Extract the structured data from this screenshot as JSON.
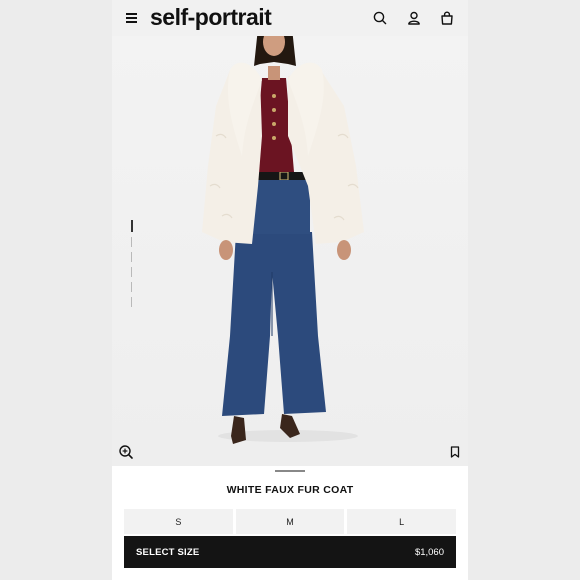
{
  "header": {
    "brand": "self-portrait",
    "icons": [
      "menu-icon",
      "search-icon",
      "account-icon",
      "bag-icon"
    ]
  },
  "gallery": {
    "image_alt": "Model wearing white faux fur coat, burgundy top and flared blue jeans",
    "page_count": 7,
    "active_page": 1
  },
  "product": {
    "title": "WHITE FAUX FUR COAT",
    "sizes": [
      "S",
      "M",
      "L"
    ],
    "cta_label": "SELECT SIZE",
    "price": "$1,060"
  },
  "colors": {
    "cta_background": "#141414",
    "coat": "#f4efe7",
    "top": "#6b1422",
    "jeans": "#2c4a7c"
  }
}
